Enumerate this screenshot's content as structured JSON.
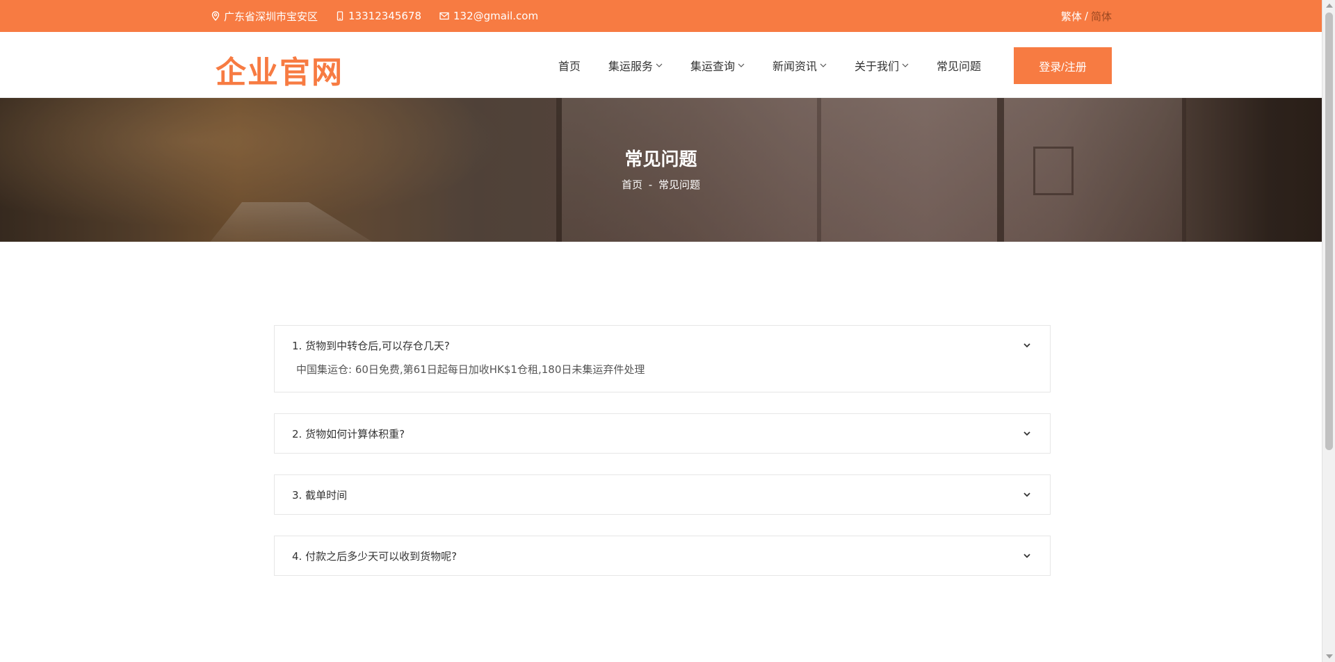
{
  "topbar": {
    "address": "广东省深圳市宝安区",
    "phone": "13312345678",
    "email": "132@gmail.com",
    "lang_traditional": "繁体",
    "lang_separator": "/",
    "lang_simplified": "简体"
  },
  "header": {
    "logo": "企业官网",
    "nav": [
      {
        "label": "首页",
        "has_dropdown": false
      },
      {
        "label": "集运服务",
        "has_dropdown": true
      },
      {
        "label": "集运查询",
        "has_dropdown": true
      },
      {
        "label": "新闻资讯",
        "has_dropdown": true
      },
      {
        "label": "关于我们",
        "has_dropdown": true
      },
      {
        "label": "常见问题",
        "has_dropdown": false
      }
    ],
    "login_label": "登录/注册"
  },
  "banner": {
    "title": "常见问题",
    "crumb_home": "首页",
    "crumb_sep": "-",
    "crumb_current": "常见问题"
  },
  "faq": [
    {
      "question": "1. 货物到中转仓后,可以存仓几天?",
      "answer": "中国集运仓: 60日免费,第61日起每日加收HK$1仓租,180日未集运弃件处理",
      "expanded": true
    },
    {
      "question": "2. 货物如何计算体积重?",
      "answer": "",
      "expanded": false
    },
    {
      "question": "3. 截单时间",
      "answer": "",
      "expanded": false
    },
    {
      "question": "4. 付款之后多少天可以收到货物呢?",
      "answer": "",
      "expanded": false
    }
  ],
  "colors": {
    "accent": "#f77b42",
    "text": "#333333"
  }
}
